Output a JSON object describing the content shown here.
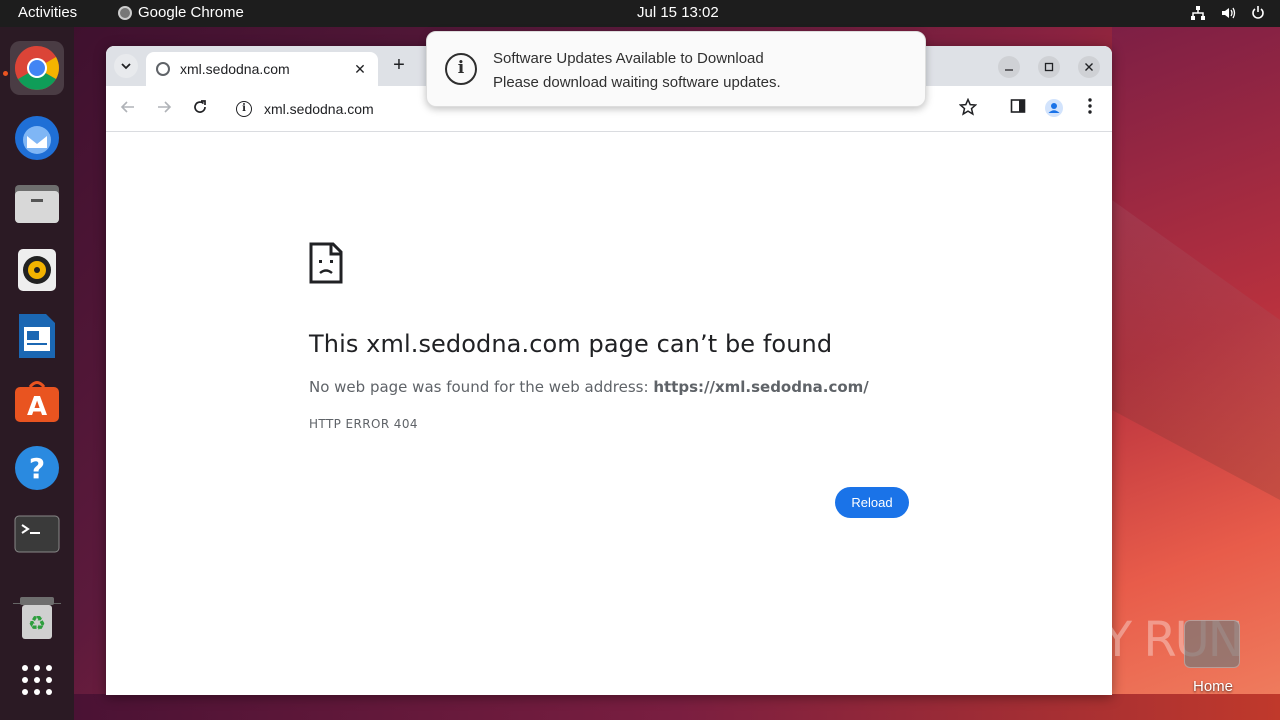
{
  "topbar": {
    "activities": "Activities",
    "app_name": "Google Chrome",
    "clock": "Jul 15  13:02"
  },
  "dock": {
    "apps": [
      "chrome-icon",
      "thunderbird-icon",
      "files-icon",
      "rhythmbox-icon",
      "libreoffice-writer-icon",
      "app-center-icon",
      "help-icon",
      "terminal-icon",
      "trash-icon",
      "show-apps-icon"
    ]
  },
  "browser": {
    "tab_title": "xml.sedodna.com",
    "tab_close": "✕",
    "new_tab": "+",
    "url": "xml.sedodna.com"
  },
  "error_page": {
    "title": "This xml.sedodna.com page can’t be found",
    "desc_prefix": "No web page was found for the web address: ",
    "desc_url": "https://xml.sedodna.com/",
    "code": "HTTP ERROR 404",
    "reload_label": "Reload"
  },
  "notification": {
    "title": "Software Updates Available to Download",
    "body": "Please download waiting software updates."
  },
  "desktop": {
    "home_label": "Home",
    "watermark": "ANY RUN"
  }
}
